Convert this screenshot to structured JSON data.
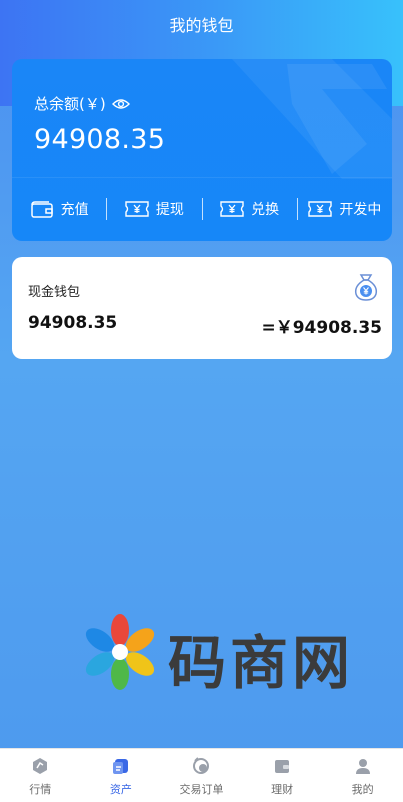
{
  "header": {
    "title": "我的钱包"
  },
  "balance": {
    "label": "总余额(￥)",
    "amount": "94908.35"
  },
  "actions": [
    {
      "label": "充值",
      "icon": "wallet-icon"
    },
    {
      "label": "提现",
      "icon": "ticket-yen-icon"
    },
    {
      "label": "兑换",
      "icon": "ticket-yen-icon"
    },
    {
      "label": "开发中",
      "icon": "ticket-yen-icon"
    }
  ],
  "wallet": {
    "title": "现金钱包",
    "amount": "94908.35",
    "equivalent": "=￥94908.35",
    "icon": "money-bag-icon"
  },
  "watermark": {
    "text": "码商网"
  },
  "tabs": [
    {
      "label": "行情",
      "icon": "market-icon",
      "active": false
    },
    {
      "label": "资产",
      "icon": "assets-icon",
      "active": true
    },
    {
      "label": "交易订单",
      "icon": "orders-icon",
      "active": false
    },
    {
      "label": "理财",
      "icon": "finance-icon",
      "active": false
    },
    {
      "label": "我的",
      "icon": "profile-icon",
      "active": false
    }
  ],
  "colors": {
    "accent": "#1687f8",
    "active_tab": "#3a68e6",
    "inactive_tab": "#6b6b6b"
  }
}
